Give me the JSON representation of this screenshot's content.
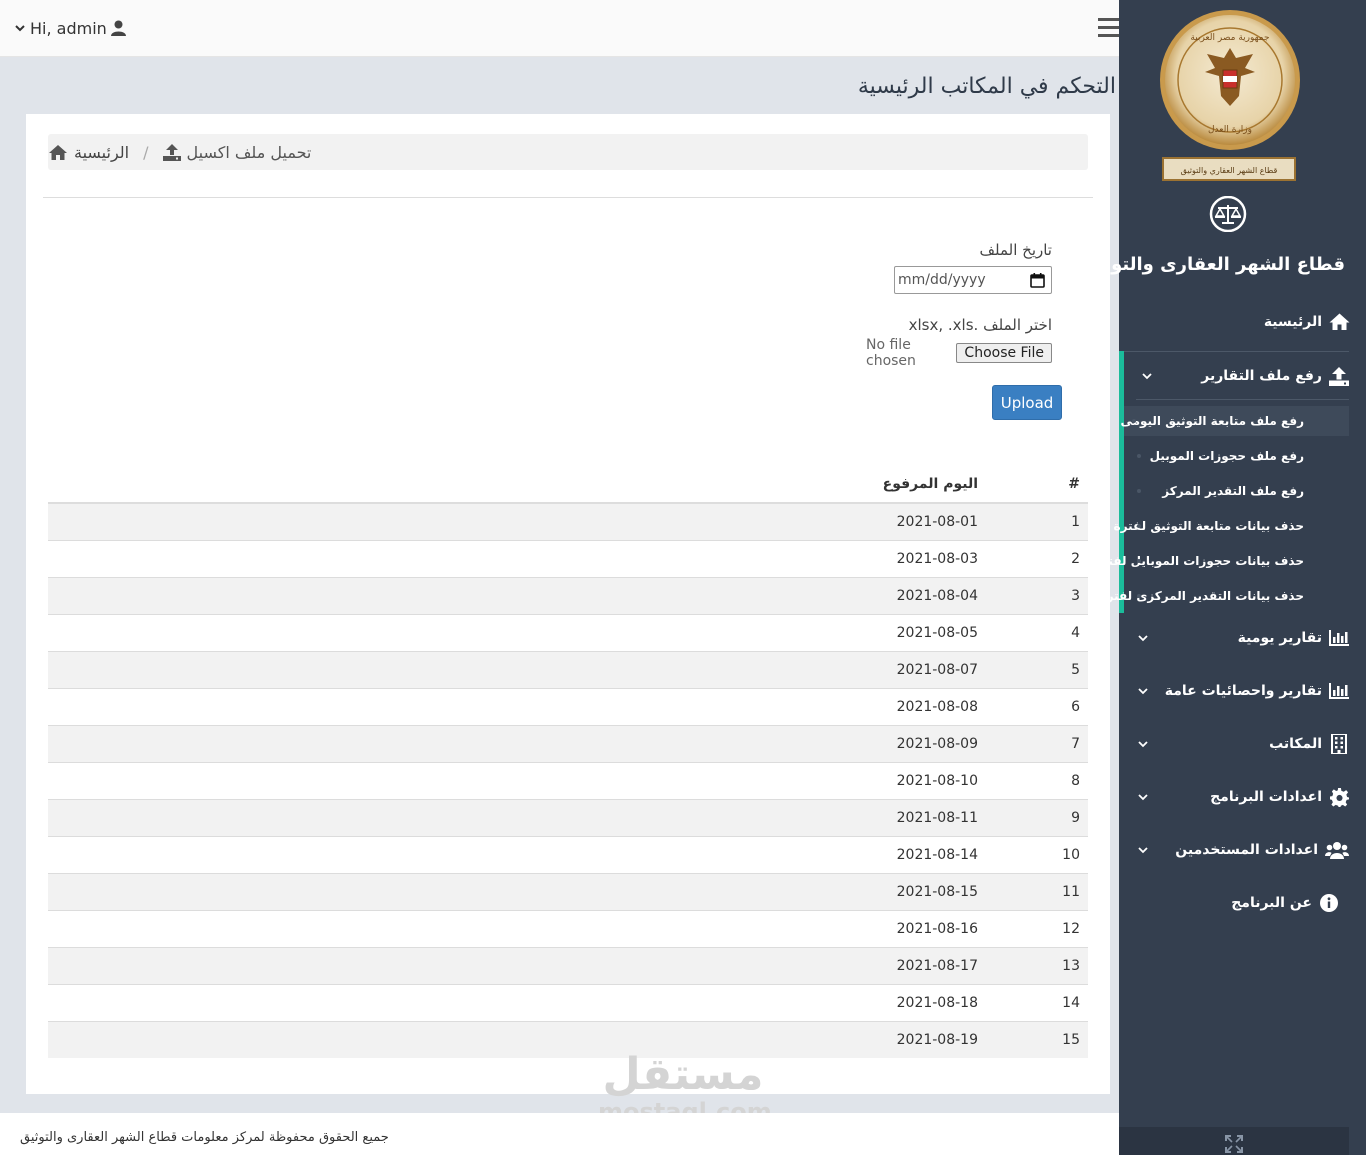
{
  "topbar": {
    "user_greeting": "Hi, admin"
  },
  "page": {
    "title": "التحكم في المكاتب الرئيسية"
  },
  "breadcrumb": {
    "home": "الرئيسية",
    "separator": "/",
    "current": "تحميل ملف اكسيل"
  },
  "form": {
    "date_label": "تاريخ الملف",
    "date_placeholder": "mm/dd/yyyy",
    "file_label": "اختر الملف .xlsx, .xls",
    "file_status": "No file chosen",
    "choose_file_label": "Choose File",
    "upload_label": "Upload"
  },
  "table": {
    "headers": {
      "num": "#",
      "date": "اليوم المرفوع"
    },
    "rows": [
      {
        "num": "1",
        "date": "2021-08-01"
      },
      {
        "num": "2",
        "date": "2021-08-03"
      },
      {
        "num": "3",
        "date": "2021-08-04"
      },
      {
        "num": "4",
        "date": "2021-08-05"
      },
      {
        "num": "5",
        "date": "2021-08-07"
      },
      {
        "num": "6",
        "date": "2021-08-08"
      },
      {
        "num": "7",
        "date": "2021-08-09"
      },
      {
        "num": "8",
        "date": "2021-08-10"
      },
      {
        "num": "9",
        "date": "2021-08-11"
      },
      {
        "num": "10",
        "date": "2021-08-14"
      },
      {
        "num": "11",
        "date": "2021-08-15"
      },
      {
        "num": "12",
        "date": "2021-08-16"
      },
      {
        "num": "13",
        "date": "2021-08-17"
      },
      {
        "num": "14",
        "date": "2021-08-18"
      },
      {
        "num": "15",
        "date": "2021-08-19"
      }
    ]
  },
  "footer": {
    "copyright": "جميع الحقوق محفوظة لمركز معلومات قطاع الشهر العقارى والتوثيق"
  },
  "watermark": {
    "arabic": "مستقل",
    "latin": "mostaql.com"
  },
  "sidebar": {
    "brand": "قطاع الشهر العقارى والتوثيق",
    "logo_text_top": "جمهورية مصر العربية",
    "logo_text_bottom": "وزارة العدل",
    "logo_banner": "قطاع الشهر العقاري والتوثيق",
    "nav": {
      "home": {
        "label": "الرئيسية",
        "icon": "home-icon"
      },
      "upload_reports": {
        "label": "رفع ملف التقارير",
        "icon": "upload-icon"
      },
      "daily_reports": {
        "label": "تقارير يومية",
        "icon": "bar-chart-icon"
      },
      "general_reports": {
        "label": "تقارير واحصائيات عامة",
        "icon": "bar-chart-icon"
      },
      "offices": {
        "label": "المكاتب",
        "icon": "building-icon"
      },
      "app_settings": {
        "label": "اعدادات البرنامج",
        "icon": "gear-icon"
      },
      "user_settings": {
        "label": "اعدادات المستخدمين",
        "icon": "users-icon"
      },
      "about": {
        "label": "عن البرنامج",
        "icon": "info-icon"
      }
    },
    "sub_items": [
      "رفع ملف متابعة التوثيق اليومى",
      "رفع ملف حجوزات الموبيل",
      "رفع ملف التقدير المركز",
      "حذف بيانات متابعة التوثيق لفترة",
      "حذف بيانات حجوزات الموبايل لفترة",
      "حذف بيانات التقدير المركزى لفترة"
    ]
  },
  "colors": {
    "sidebar_bg": "#343f4f",
    "accent": "#1bbc9b",
    "primary_button": "#3a7fc2",
    "page_bg": "#e0e4ea"
  }
}
